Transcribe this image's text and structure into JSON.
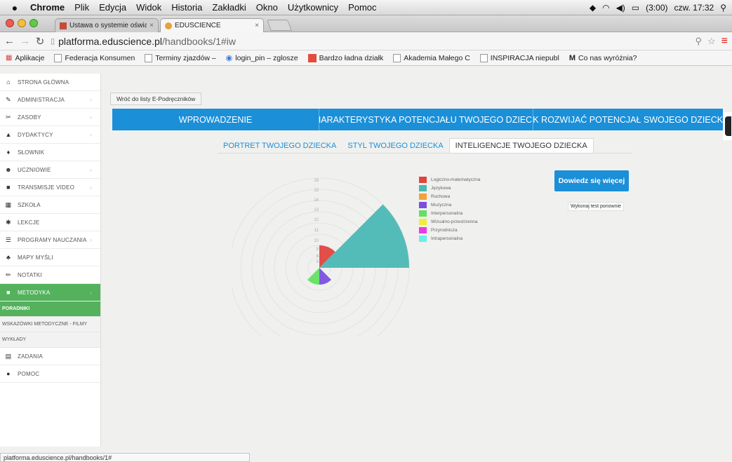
{
  "menubar": {
    "app": "Chrome",
    "items": [
      "Plik",
      "Edycja",
      "Widok",
      "Historia",
      "Zakładki",
      "Okno",
      "Użytkownicy",
      "Pomoc"
    ],
    "battery": "(3:00)",
    "clock": "czw. 17:32"
  },
  "tabs": [
    {
      "title": "Ustawa o systemie oświat",
      "active": false
    },
    {
      "title": "EDUSCIENCE",
      "active": true
    }
  ],
  "toolbar": {
    "url_domain": "platforma.eduscience.pl",
    "url_path": "/handbooks/1#iw"
  },
  "bookmarks": [
    {
      "label": "Aplikacje"
    },
    {
      "label": "Federacja Konsumen"
    },
    {
      "label": "Terminy zjazdów –"
    },
    {
      "label": "login_pin – zglosze"
    },
    {
      "label": "Bardzo ładna działk"
    },
    {
      "label": "Akademia Małego C"
    },
    {
      "label": "INSPIRACJA niepubl"
    },
    {
      "label": "Co nas wyróżnia?"
    }
  ],
  "sidebar": {
    "items": [
      {
        "label": "STRONA GŁÓWNA",
        "icon": "home-icon",
        "glyph": "⌂",
        "arrow": false
      },
      {
        "label": "ADMINISTRACJA",
        "icon": "wrench-icon",
        "glyph": "✎",
        "arrow": true
      },
      {
        "label": "ZASOBY",
        "icon": "tools-icon",
        "glyph": "✂",
        "arrow": true
      },
      {
        "label": "DYDAKTYCY",
        "icon": "teacher-icon",
        "glyph": "▲",
        "arrow": true
      },
      {
        "label": "SŁOWNIK",
        "icon": "dictionary-icon",
        "glyph": "♦",
        "arrow": false
      },
      {
        "label": "UCZNIOWIE",
        "icon": "students-icon",
        "glyph": "☻",
        "arrow": true
      },
      {
        "label": "TRANSMISJE VIDEO",
        "icon": "video-icon",
        "glyph": "■",
        "arrow": true
      },
      {
        "label": "SZKOŁA",
        "icon": "school-icon",
        "glyph": "▦",
        "arrow": false
      },
      {
        "label": "LEKCJE",
        "icon": "lessons-icon",
        "glyph": "✱",
        "arrow": false
      },
      {
        "label": "PROGRAMY NAUCZANIA",
        "icon": "curriculum-icon",
        "glyph": "☰",
        "arrow": true
      },
      {
        "label": "MAPY MYŚLI",
        "icon": "mindmap-icon",
        "glyph": "♣",
        "arrow": false
      },
      {
        "label": "NOTATKI",
        "icon": "notes-icon",
        "glyph": "✏",
        "arrow": false
      },
      {
        "label": "METODYKA",
        "icon": "methodology-icon",
        "glyph": "■",
        "arrow": true,
        "active": true
      }
    ],
    "subitems": [
      {
        "label": "PORADNIKI",
        "selected": true
      },
      {
        "label": "WSKAZÓWKI METODYCZNE - FILMY",
        "selected": false
      },
      {
        "label": "WYKŁADY",
        "selected": false
      }
    ],
    "bottom_items": [
      {
        "label": "ZADANIA",
        "icon": "tasks-icon",
        "glyph": "▤"
      },
      {
        "label": "POMOC",
        "icon": "help-icon",
        "glyph": "●"
      }
    ]
  },
  "main": {
    "back_label": "Wróć do listy E-Podręczników",
    "nav": [
      "WPROWADZENIE",
      "CHARAKTERYSTYKA POTENCJAŁU TWOJEGO DZIECKA",
      "JAK ROZWIJAĆ POTENCJAŁ SWOJEGO DZIECKA?"
    ],
    "subnav": [
      "PORTRET TWOJEGO DZIECKA",
      "STYL TWOJEGO DZIECKA",
      "INTELIGENCJE TWOJEGO DZIECKA"
    ],
    "learn_more": "Dowiedz się więcej",
    "retake": "Wykonaj test ponownie"
  },
  "chart_data": {
    "type": "polar-area",
    "categories": [
      "Logiczno-matematyczna",
      "Językowa",
      "Ruchowa",
      "Muzyczna",
      "Interpersonalna",
      "Wizualno-przestrzenna",
      "Przyrodnicza",
      "Intrapersonalna"
    ],
    "values": [
      4,
      16,
      0,
      3,
      3,
      0,
      0,
      0
    ],
    "colors": [
      "#e0443f",
      "#4bb8b4",
      "#f0a23c",
      "#7a4fe0",
      "#63e063",
      "#f0ee3a",
      "#e83be0",
      "#66f0ee"
    ],
    "radial_ticks": [
      "5",
      "6",
      "9",
      "10",
      "11",
      "12",
      "13",
      "14",
      "15",
      "16"
    ],
    "rmax": 16
  },
  "statusbar": "platforma.eduscience.pl/handbooks/1#"
}
